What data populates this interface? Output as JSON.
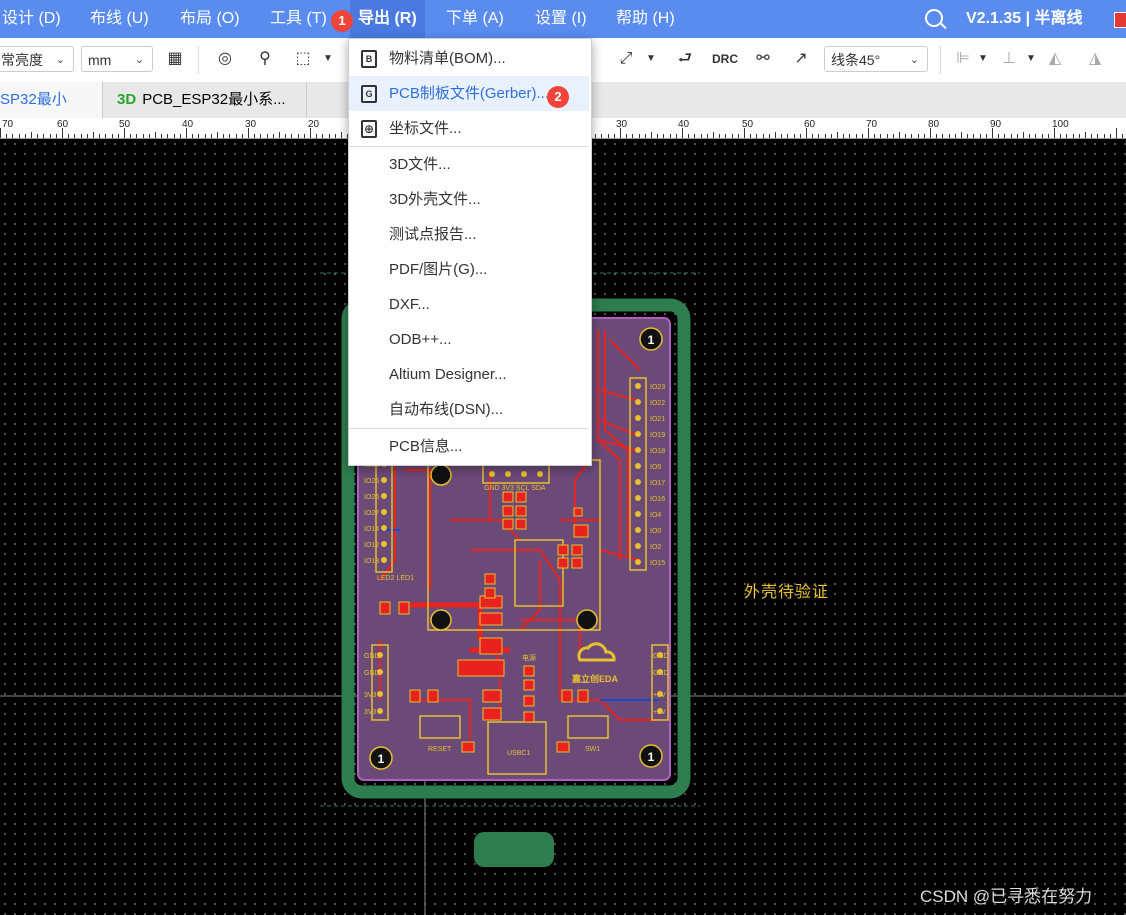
{
  "menubar": {
    "items": [
      {
        "label": "设计 (D)"
      },
      {
        "label": "布线 (U)"
      },
      {
        "label": "布局 (O)"
      },
      {
        "label": "工具 (T)"
      },
      {
        "label": "导出 (R)"
      },
      {
        "label": "下单 (A)"
      },
      {
        "label": "设置 (I)"
      },
      {
        "label": "帮助 (H)"
      }
    ],
    "version": "V2.1.35 | 半离线",
    "badge_export": "1"
  },
  "toolbar": {
    "brightness": "常亮度",
    "unit": "mm",
    "drc": "DRC",
    "line_mode": "线条45°"
  },
  "tabs": [
    {
      "label": "SP32最小系..."
    },
    {
      "prefix": "3D",
      "label": "PCB_ESP32最小系..."
    }
  ],
  "ruler": {
    "labels": [
      "70",
      "60",
      "50",
      "40",
      "30",
      "20",
      "30",
      "40",
      "50",
      "60",
      "70",
      "80",
      "90",
      "100"
    ]
  },
  "export_menu": {
    "items": [
      {
        "label": "物料清单(BOM)...",
        "icon": "B"
      },
      {
        "label": "PCB制板文件(Gerber)...",
        "icon": "G"
      },
      {
        "label": "坐标文件...",
        "icon": "coordinate-icon"
      },
      {
        "label": "3D文件..."
      },
      {
        "label": "3D外壳文件..."
      },
      {
        "label": "测试点报告..."
      },
      {
        "label": "PDF/图片(G)..."
      },
      {
        "label": "DXF..."
      },
      {
        "label": "ODB++..."
      },
      {
        "label": "Altium Designer..."
      },
      {
        "label": "自动布线(DSN)..."
      },
      {
        "label": "PCB信息..."
      }
    ],
    "badge_gerber": "2"
  },
  "pcb": {
    "annotation": "外壳待验证",
    "labels_left": [
      "IO33",
      "IO25",
      "IO26",
      "IO27",
      "IO14",
      "IO12",
      "IO13"
    ],
    "labels_right": [
      "IO23",
      "IO22",
      "IO21",
      "IO19",
      "IO18",
      "IO5",
      "IO17",
      "IO16",
      "IO4",
      "IO0",
      "IO2",
      "IO15"
    ],
    "labels_bottom_left": [
      "GND",
      "GND",
      "3V3",
      "3V3"
    ],
    "labels_bottom_right": [
      "GND",
      "GND",
      "+5V",
      "+5V"
    ],
    "header_labels": "GND 3V3 SCL SDA",
    "reset": "RESET",
    "sw1": "SW1",
    "usbc": "USBC1",
    "power": "电源",
    "logo_text": "嘉立创EDA",
    "led_labels": "LED2 LED1",
    "mount_hole": "1"
  },
  "colors": {
    "menubar": "#5a8cf0",
    "board_fill": "#6b4a78",
    "trace": "#e8231f",
    "silkscreen": "#e8c030",
    "outline": "#2e7d4e"
  },
  "watermark": "CSDN @已寻悉在努力"
}
